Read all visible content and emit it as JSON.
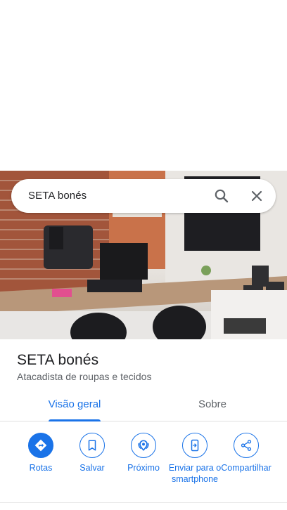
{
  "search": {
    "query": "SETA bonés"
  },
  "place": {
    "name": "SETA bonés",
    "category": "Atacadista de roupas e tecidos"
  },
  "tabs": [
    {
      "label": "Visão geral",
      "active": true
    },
    {
      "label": "Sobre",
      "active": false
    }
  ],
  "actions": [
    {
      "label": "Rotas",
      "icon": "directions-icon",
      "filled": true
    },
    {
      "label": "Salvar",
      "icon": "bookmark-icon",
      "filled": false
    },
    {
      "label": "Próximo",
      "icon": "nearby-icon",
      "filled": false
    },
    {
      "label": "Enviar para o smartphone",
      "icon": "send-to-phone-icon",
      "filled": false
    },
    {
      "label": "Compartilhar",
      "icon": "share-icon",
      "filled": false
    }
  ],
  "colors": {
    "accent": "#1a73e8",
    "text_primary": "#202124",
    "text_secondary": "#5f6368"
  }
}
